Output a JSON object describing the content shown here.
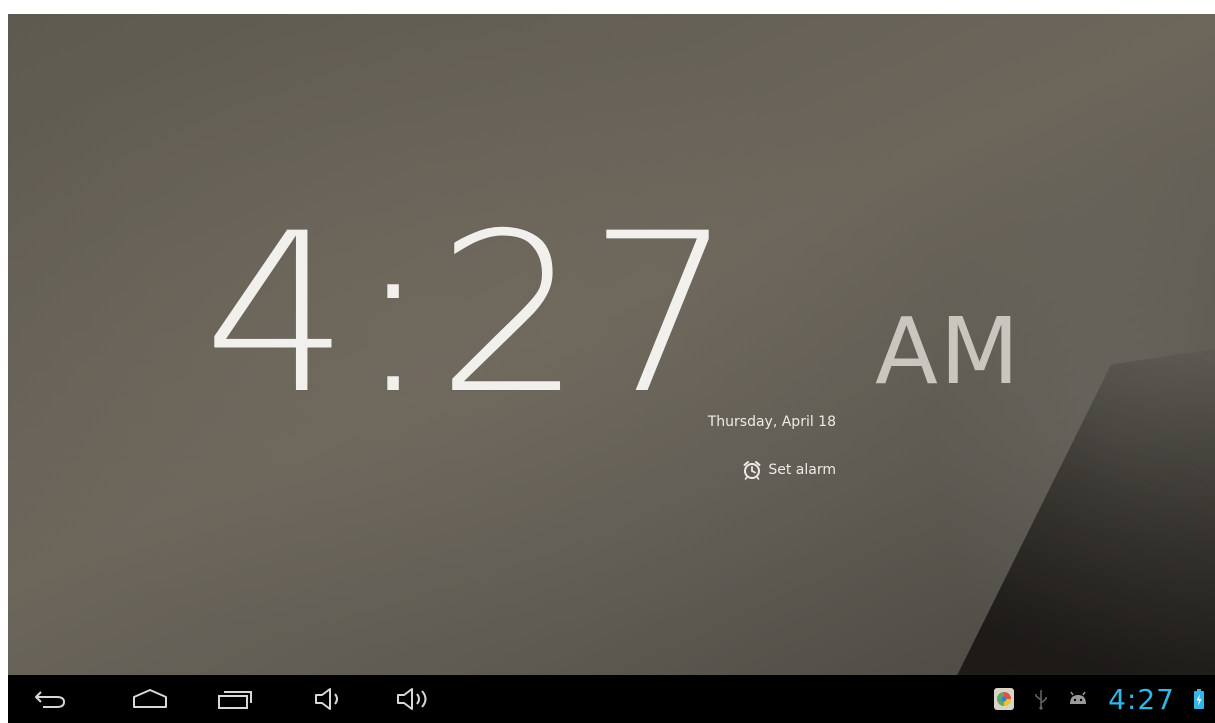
{
  "lockscreen": {
    "time": "4:27",
    "ampm": "AM",
    "date": "Thursday, April 18",
    "alarm_label": "Set alarm",
    "alarm_icon": "alarm-clock-icon"
  },
  "navbar": {
    "buttons": [
      {
        "name": "back",
        "icon": "back-arrow-icon"
      },
      {
        "name": "home",
        "icon": "home-icon"
      },
      {
        "name": "recent-apps",
        "icon": "recent-apps-icon"
      },
      {
        "name": "volume-down",
        "icon": "volume-down-icon"
      },
      {
        "name": "volume-up",
        "icon": "volume-up-icon"
      }
    ],
    "status": {
      "clock": "4:27",
      "icons": [
        "app-notification-icon",
        "usb-icon",
        "android-debug-icon",
        "battery-charging-icon"
      ],
      "accent_color": "#33b5e5"
    }
  },
  "colors": {
    "clock_text": "#f2f0ec",
    "ampm_text": "#c9c6c0",
    "navbar_bg": "#000000"
  }
}
